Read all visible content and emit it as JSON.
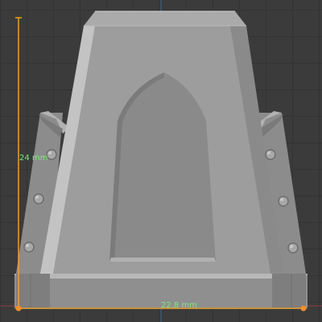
{
  "viewport": {
    "dimensions": {
      "height": {
        "value": "24 mm"
      },
      "width": {
        "value": "22.8 mm"
      }
    }
  },
  "colors": {
    "background": "#3b3b3b",
    "grid": "#333333",
    "axis_x": "#8a4040",
    "axis_y": "#3f6a8a",
    "dimension_line": "#e8a030",
    "dimension_text": "#7de87d",
    "dimension_endpoint": "#f0902a",
    "model_face": "#9c9c9c",
    "model_light": "#c4c4c4",
    "model_dark": "#787878"
  }
}
